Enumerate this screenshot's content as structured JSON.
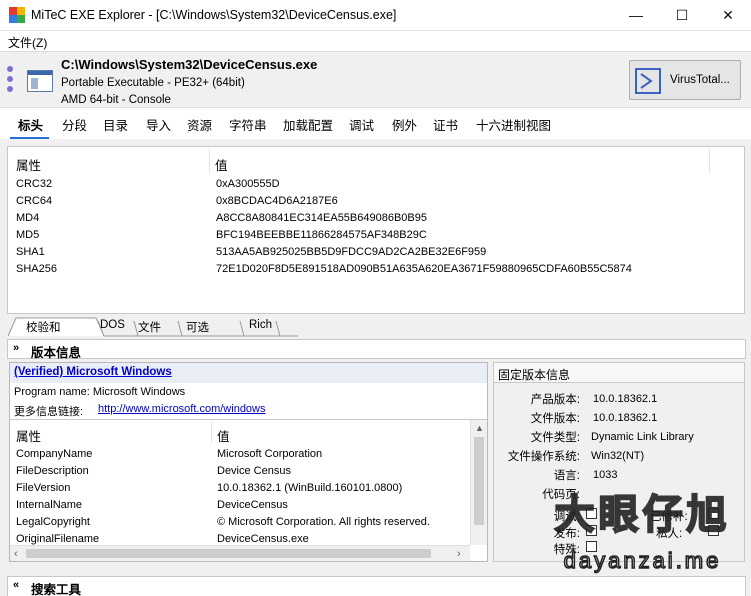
{
  "window": {
    "title": "MiTeC EXE Explorer - [C:\\Windows\\System32\\DeviceCensus.exe]",
    "minimize": "—",
    "maximize": "☐",
    "close": "✕"
  },
  "menu": {
    "file": "文件(Z)"
  },
  "file": {
    "path": "C:\\Windows\\System32\\DeviceCensus.exe",
    "type": "Portable Executable - PE32+ (64bit)",
    "arch": "AMD 64-bit - Console",
    "virustotal_label": "VirusTotal..."
  },
  "tabs": [
    "标头",
    "分段",
    "目录",
    "导入",
    "资源",
    "字符串",
    "加载配置",
    "调试",
    "例外",
    "证书",
    "十六进制视图"
  ],
  "hashes": {
    "col_property": "属性",
    "col_value": "值",
    "rows": [
      {
        "name": "CRC32",
        "value": "0xA300555D"
      },
      {
        "name": "CRC64",
        "value": "0x8BCDAC4D6A2187E6"
      },
      {
        "name": "MD4",
        "value": "A8CC8A80841EC314EA55B649086B0B95"
      },
      {
        "name": "MD5",
        "value": "BFC194BEEBBE11866284575AF348B29C"
      },
      {
        "name": "SHA1",
        "value": "513AA5AB925025BB5D9FDCC9AD2CA2BE32E6F959"
      },
      {
        "name": "SHA256",
        "value": "72E1D020F8D5E891518AD090B51A635A620EA3671F59880965CDFA60B55C5874"
      }
    ]
  },
  "subtabs": [
    "校验和",
    "DOS",
    "文件",
    "可选",
    "Rich"
  ],
  "version_section": {
    "title": "版本信息",
    "verified": "(Verified) Microsoft Windows",
    "program_name": "Program name: Microsoft Windows",
    "more_info_label": "更多信息链接:",
    "more_info_url": "http://www.microsoft.com/windows",
    "col_property": "属性",
    "col_value": "值",
    "rows": [
      {
        "name": "CompanyName",
        "value": "Microsoft Corporation"
      },
      {
        "name": "FileDescription",
        "value": "Device Census"
      },
      {
        "name": "FileVersion",
        "value": "10.0.18362.1 (WinBuild.160101.0800)"
      },
      {
        "name": "InternalName",
        "value": "DeviceCensus"
      },
      {
        "name": "LegalCopyright",
        "value": "© Microsoft Corporation. All rights reserved."
      },
      {
        "name": "OriginalFilename",
        "value": "DeviceCensus.exe"
      }
    ]
  },
  "fixed_version": {
    "title": "固定版本信息",
    "rows": [
      {
        "label": "产品版本:",
        "value": "10.0.18362.1"
      },
      {
        "label": "文件版本:",
        "value": "10.0.18362.1"
      },
      {
        "label": "文件类型:",
        "value": "Dynamic Link Library"
      },
      {
        "label": "文件操作系统:",
        "value": "Win32(NT)"
      },
      {
        "label": "语言:",
        "value": "1033"
      },
      {
        "label": "代码页:",
        "value": ""
      },
      {
        "label": "调试:",
        "value": ""
      },
      {
        "label": "发布:",
        "value": ""
      },
      {
        "label": "特殊:",
        "value": ""
      }
    ],
    "extra_labels": {
      "patched": "已修补:",
      "private": "私人:"
    }
  },
  "search_section": {
    "title": "搜索工具"
  },
  "watermark": {
    "text": "大眼仔旭",
    "url": "dayanzai.me"
  },
  "colors": {
    "accent": "#2a6fd3",
    "link": "#0000cc",
    "virustotal": "#3b62c4"
  }
}
